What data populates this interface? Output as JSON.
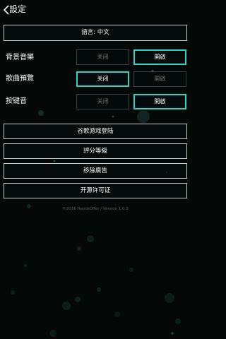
{
  "header": {
    "title": "設定",
    "back_icon": "chevron-left-icon"
  },
  "language_button": {
    "label": "語言: 中文"
  },
  "settings": [
    {
      "label": "背景音樂",
      "off_label": "关闭",
      "on_label": "開啟",
      "active": "on"
    },
    {
      "label": "歌曲預覽",
      "off_label": "关闭",
      "on_label": "開啟",
      "active": "off"
    },
    {
      "label": "按键音",
      "off_label": "关闭",
      "on_label": "開啟",
      "active": "on"
    }
  ],
  "menu": [
    {
      "label": "谷歌游戏登陆"
    },
    {
      "label": "評分等級"
    },
    {
      "label": "移除廣告"
    },
    {
      "label": "开源许可证"
    }
  ],
  "footer": {
    "text": "©2016 HandsOffer / Version 1.0.5"
  },
  "colors": {
    "accent": "#2fd3c4",
    "background": "#040908",
    "border": "#c9cfce"
  }
}
